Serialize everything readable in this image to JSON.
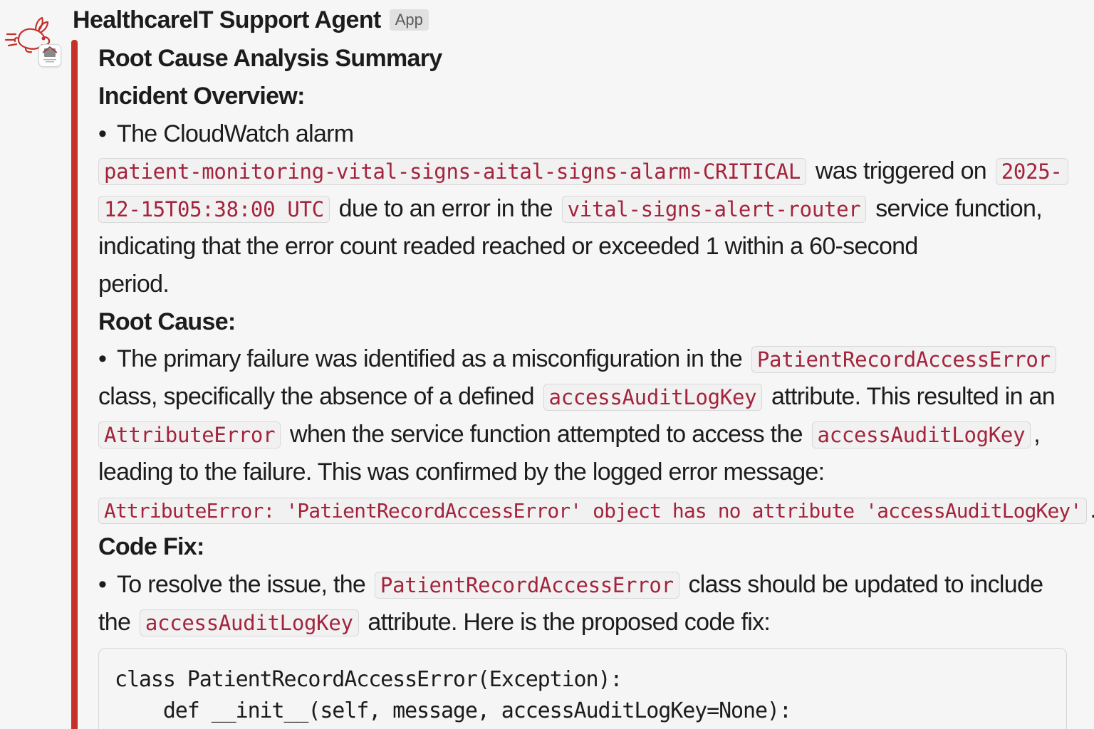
{
  "message": {
    "sender_name": "HealthcareIT Support Agent",
    "app_tag": "App",
    "title": "Root Cause Analysis Summary",
    "incident_overview": {
      "heading": "Incident Overview:",
      "t1": "The CloudWatch alarm",
      "alarm_name": "patient-monitoring-vital-signs-aital-signs-alarm-CRITICAL",
      "t2": "was triggered on",
      "timestamp_part1": "2025-",
      "timestamp_part2": "12-15T05:38:00 UTC",
      "t3": "due to an error in the",
      "service_name": "vital-signs-alert-router",
      "t4": "service function,",
      "t5": "indicating that the error count readed reached or exceeded 1 within a 60-second",
      "t6": "period."
    },
    "root_cause": {
      "heading": "Root Cause:",
      "t1": "The primary failure was identified as a misconfiguration in the",
      "class_name": "PatientRecordAccessError",
      "t2": "class, specifically the absence of a defined",
      "attr_name": "accessAuditLogKey",
      "t3": "attribute. This resulted in an",
      "error_type": "AttributeError",
      "t4": "when the service function attempted to access the",
      "attr_name_2": "accessAuditLogKey",
      "t5": ",",
      "t6": "leading to the failure. This was confirmed by the logged error message:",
      "error_message": "AttributeError: 'PatientRecordAccessError' object has no attribute 'accessAuditLogKey'",
      "t7": "."
    },
    "code_fix": {
      "heading": "Code Fix:",
      "t1": "To resolve the issue, the",
      "class_name": "PatientRecordAccessError",
      "t2": "class should be updated to include",
      "t3": "the",
      "attr_name": "accessAuditLogKey",
      "t4": "attribute. Here is the proposed code fix:",
      "code_lines": [
        "class PatientRecordAccessError(Exception):",
        "    def __init__(self, message, accessAuditLogKey=None):"
      ]
    }
  },
  "colors": {
    "accent_bar": "#c4312b",
    "inline_code_text": "#a3243c",
    "inline_code_bg": "#f1f1f1"
  }
}
